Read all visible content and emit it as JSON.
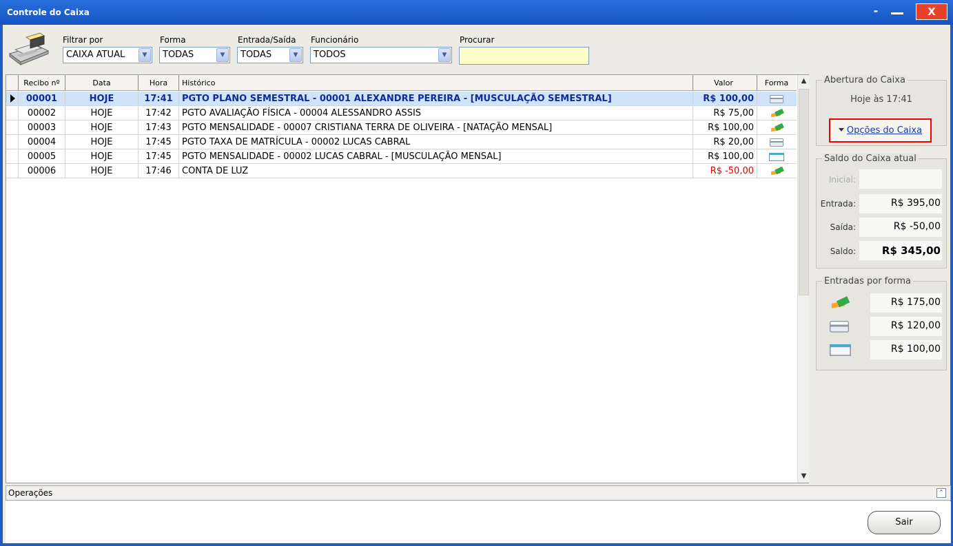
{
  "window": {
    "title": "Controle do Caixa",
    "minimize": "-",
    "close": "X"
  },
  "filters": {
    "filtrar_label": "Filtrar por",
    "filtrar_value": "CAIXA ATUAL",
    "forma_label": "Forma",
    "forma_value": "TODAS",
    "entrada_saida_label": "Entrada/Saída",
    "entrada_saida_value": "TODAS",
    "funcionario_label": "Funcionário",
    "funcionario_value": "TODOS",
    "procurar_label": "Procurar",
    "procurar_value": ""
  },
  "grid": {
    "columns": [
      "Recibo nº",
      "Data",
      "Hora",
      "Histórico",
      "Valor",
      "Forma"
    ],
    "rows": [
      {
        "recibo": "00001",
        "data": "HOJE",
        "hora": "17:41",
        "historico": "PGTO PLANO SEMESTRAL - 00001 ALEXANDRE PEREIRA - [MUSCULAÇÃO SEMESTRAL]",
        "valor": "R$ 100,00",
        "forma": "card-icon"
      },
      {
        "recibo": "00002",
        "data": "HOJE",
        "hora": "17:42",
        "historico": "PGTO AVALIAÇÃO FÍSICA - 00004 ALESSANDRO ASSIS",
        "valor": "R$ 75,00",
        "forma": "cash-icon"
      },
      {
        "recibo": "00003",
        "data": "HOJE",
        "hora": "17:43",
        "historico": "PGTO MENSALIDADE - 00007 CRISTIANA TERRA DE OLIVEIRA - [NATAÇÃO MENSAL]",
        "valor": "R$ 100,00",
        "forma": "cash-icon"
      },
      {
        "recibo": "00004",
        "data": "HOJE",
        "hora": "17:45",
        "historico": "PGTO TAXA DE MATRÍCULA - 00002 LUCAS CABRAL",
        "valor": "R$ 20,00",
        "forma": "card-icon"
      },
      {
        "recibo": "00005",
        "data": "HOJE",
        "hora": "17:45",
        "historico": "PGTO MENSALIDADE - 00002 LUCAS CABRAL - [MUSCULAÇÃO MENSAL]",
        "valor": "R$ 100,00",
        "forma": "check-icon"
      },
      {
        "recibo": "00006",
        "data": "HOJE",
        "hora": "17:46",
        "historico": "CONTA DE LUZ",
        "valor": "R$ -50,00",
        "forma": "cash-icon"
      }
    ]
  },
  "abertura": {
    "legend": "Abertura do Caixa",
    "value": "Hoje às 17:41"
  },
  "opcoes": {
    "label": "Opções do Caixa"
  },
  "saldo": {
    "legend": "Saldo do Caixa atual",
    "inicial_label": "Inicial:",
    "inicial_value": "",
    "entrada_label": "Entrada:",
    "entrada_value": "R$ 395,00",
    "saida_label": "Saída:",
    "saida_value": "R$ -50,00",
    "saldo_label": "Saldo:",
    "saldo_value": "R$ 345,00"
  },
  "entradas_forma": {
    "legend": "Entradas por forma",
    "items": [
      {
        "icon": "cash-icon",
        "value": "R$ 175,00"
      },
      {
        "icon": "card-icon",
        "value": "R$ 120,00"
      },
      {
        "icon": "check-icon",
        "value": "R$ 100,00"
      }
    ]
  },
  "operacoes": {
    "label": "Operações"
  },
  "sair": {
    "label": "Sair"
  },
  "colors": {
    "titlebar": "#1f5cc4",
    "selected_row": "#cfe4fb",
    "negative": "#e00000",
    "search_bg": "#ffffc8",
    "highlight_border": "#e00000"
  }
}
